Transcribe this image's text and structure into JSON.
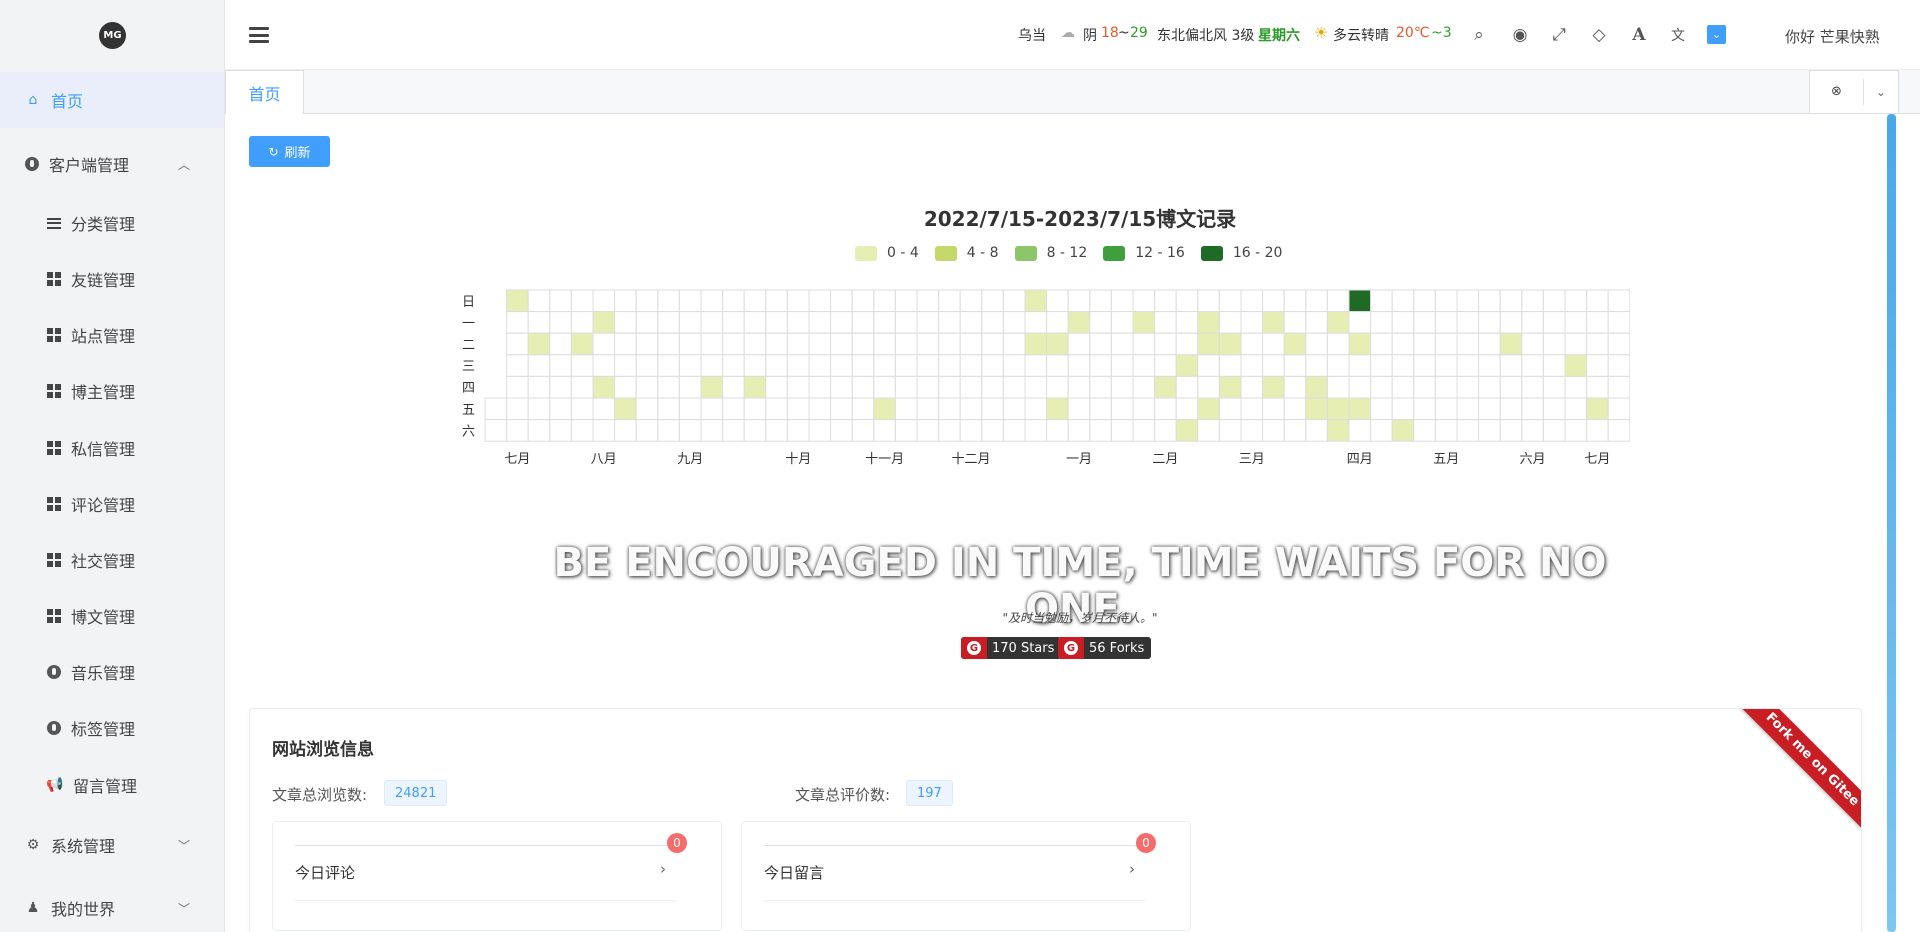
{
  "sidebar": {
    "logo": "MG",
    "items": [
      {
        "label": "首页"
      },
      {
        "label": "客户端管理"
      },
      {
        "label": "分类管理"
      },
      {
        "label": "友链管理"
      },
      {
        "label": "站点管理"
      },
      {
        "label": "博主管理"
      },
      {
        "label": "私信管理"
      },
      {
        "label": "评论管理"
      },
      {
        "label": "社交管理"
      },
      {
        "label": "博文管理"
      },
      {
        "label": "音乐管理"
      },
      {
        "label": "标签管理"
      },
      {
        "label": "留言管理"
      },
      {
        "label": "系统管理"
      },
      {
        "label": "我的世界"
      }
    ]
  },
  "header": {
    "city": "乌当",
    "weather1": "阴",
    "temp1_low": "18",
    "temp1_sep": "~",
    "temp1_high": "29",
    "wind": "东北偏北风 3级",
    "weekday": "星期六",
    "weather2": "多云转晴",
    "temp2": "20℃",
    "temp2_sep": "~3",
    "greeting": "你好 芒果快熟",
    "icons": [
      "menu-icon",
      "search-icon",
      "target-icon",
      "fullscreen-icon",
      "diamond-icon",
      "font-icon",
      "translate-icon",
      "dropdown-icon"
    ]
  },
  "tabs": {
    "active": "首页",
    "close": "⊗",
    "more": "⌄"
  },
  "main": {
    "refresh": "刷新",
    "chart_title": "2022/7/15-2023/7/15博文记录",
    "motto": "BE ENCOURAGED IN TIME, TIME WAITS FOR NO ONE.",
    "quote": "\"及时当勉励，岁月不待人。\"",
    "stars": "170 Stars",
    "forks": "56 Forks",
    "stats_title": "网站浏览信息",
    "views_label": "文章总浏览数:",
    "views_value": "24821",
    "comments_label": "文章总评价数:",
    "comments_value": "197",
    "today_comments": "今日评论",
    "today_comments_count": "0",
    "today_messages": "今日留言",
    "today_messages_count": "0",
    "ribbon": "Fork me on Gitee"
  },
  "chart_data": {
    "type": "heatmap",
    "title": "2022/7/15-2023/7/15博文记录",
    "legend": [
      {
        "label": "0 - 4",
        "color": "#e6eeb4"
      },
      {
        "label": "4 - 8",
        "color": "#c5d96a"
      },
      {
        "label": "8 - 12",
        "color": "#8dc56a"
      },
      {
        "label": "12 - 16",
        "color": "#3f9f3f"
      },
      {
        "label": "16 - 20",
        "color": "#1f6a26"
      }
    ],
    "y_labels": [
      "日",
      "一",
      "二",
      "三",
      "四",
      "五",
      "六"
    ],
    "x_labels": [
      {
        "label": "七月",
        "week": 1
      },
      {
        "label": "八月",
        "week": 5
      },
      {
        "label": "九月",
        "week": 9
      },
      {
        "label": "十月",
        "week": 14
      },
      {
        "label": "十一月",
        "week": 18
      },
      {
        "label": "十二月",
        "week": 22
      },
      {
        "label": "一月",
        "week": 27
      },
      {
        "label": "二月",
        "week": 31
      },
      {
        "label": "三月",
        "week": 35
      },
      {
        "label": "四月",
        "week": 40
      },
      {
        "label": "五月",
        "week": 44
      },
      {
        "label": "六月",
        "week": 48
      },
      {
        "label": "七月",
        "week": 51
      }
    ],
    "weeks": 53,
    "cells": [
      {
        "week": 1,
        "day": 0,
        "level": 0
      },
      {
        "week": 2,
        "day": 2,
        "level": 0
      },
      {
        "week": 4,
        "day": 2,
        "level": 0
      },
      {
        "week": 5,
        "day": 1,
        "level": 0
      },
      {
        "week": 5,
        "day": 4,
        "level": 0
      },
      {
        "week": 6,
        "day": 5,
        "level": 0
      },
      {
        "week": 10,
        "day": 4,
        "level": 0
      },
      {
        "week": 12,
        "day": 4,
        "level": 0
      },
      {
        "week": 18,
        "day": 5,
        "level": 0
      },
      {
        "week": 25,
        "day": 0,
        "level": 0
      },
      {
        "week": 25,
        "day": 2,
        "level": 0
      },
      {
        "week": 26,
        "day": 2,
        "level": 0
      },
      {
        "week": 26,
        "day": 5,
        "level": 0
      },
      {
        "week": 27,
        "day": 1,
        "level": 0
      },
      {
        "week": 30,
        "day": 1,
        "level": 0
      },
      {
        "week": 31,
        "day": 4,
        "level": 0
      },
      {
        "week": 32,
        "day": 3,
        "level": 0
      },
      {
        "week": 32,
        "day": 6,
        "level": 0
      },
      {
        "week": 33,
        "day": 1,
        "level": 0
      },
      {
        "week": 33,
        "day": 2,
        "level": 0
      },
      {
        "week": 33,
        "day": 5,
        "level": 0
      },
      {
        "week": 34,
        "day": 2,
        "level": 0
      },
      {
        "week": 34,
        "day": 4,
        "level": 0
      },
      {
        "week": 36,
        "day": 1,
        "level": 0
      },
      {
        "week": 36,
        "day": 4,
        "level": 0
      },
      {
        "week": 37,
        "day": 2,
        "level": 0
      },
      {
        "week": 38,
        "day": 4,
        "level": 0
      },
      {
        "week": 38,
        "day": 5,
        "level": 0
      },
      {
        "week": 39,
        "day": 1,
        "level": 0
      },
      {
        "week": 39,
        "day": 5,
        "level": 0
      },
      {
        "week": 39,
        "day": 6,
        "level": 0
      },
      {
        "week": 40,
        "day": 0,
        "level": 4
      },
      {
        "week": 40,
        "day": 2,
        "level": 0
      },
      {
        "week": 40,
        "day": 5,
        "level": 0
      },
      {
        "week": 42,
        "day": 6,
        "level": 0
      },
      {
        "week": 47,
        "day": 2,
        "level": 0
      },
      {
        "week": 50,
        "day": 3,
        "level": 0
      },
      {
        "week": 51,
        "day": 5,
        "level": 0
      }
    ]
  }
}
